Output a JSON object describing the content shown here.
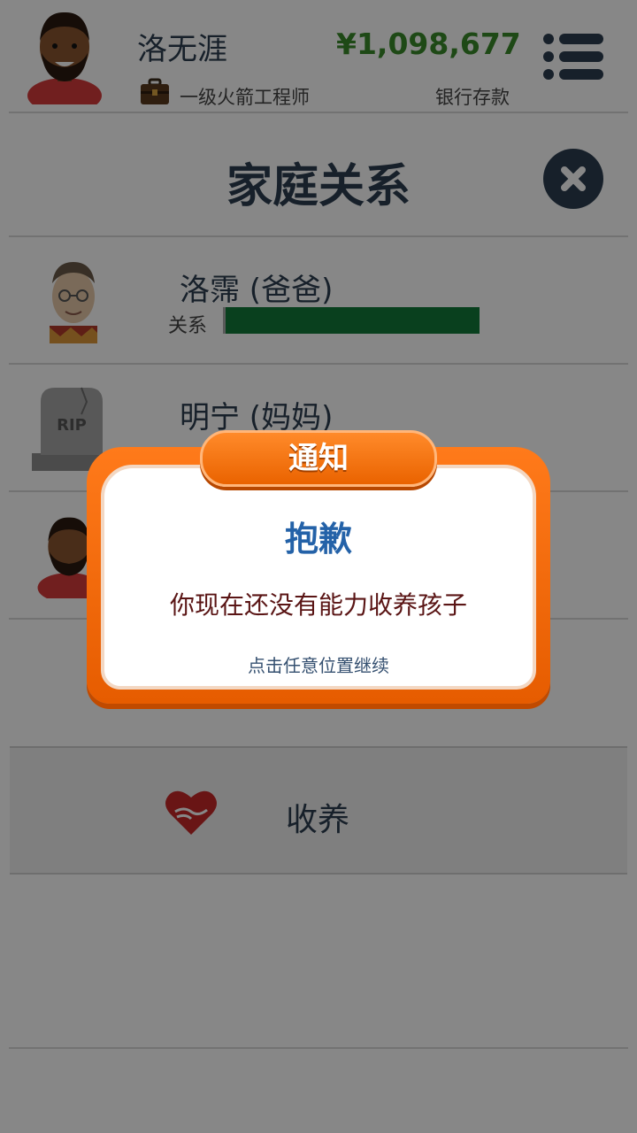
{
  "header": {
    "player_name": "洛无涯",
    "job_title": "一级火箭工程师",
    "money": "¥1,098,677",
    "bank_label": "银行存款",
    "icons": [
      "player-avatar",
      "briefcase-icon",
      "menu-icon"
    ]
  },
  "page": {
    "title": "家庭关系",
    "close_icon": "close-icon"
  },
  "relatives": [
    {
      "name": "洛霈 (爸爸)",
      "relation_label": "关系",
      "relationship_level": 1.0,
      "avatar": "elderly-man-avatar"
    },
    {
      "name": "明宁 (妈妈)",
      "avatar": "rip-tombstone-icon"
    },
    {
      "avatar": "bearded-man-avatar"
    }
  ],
  "adopt": {
    "label": "收养",
    "icon": "heart-hands-icon",
    "icon_color": "#c62828"
  },
  "modal": {
    "tab_title": "通知",
    "heading": "抱歉",
    "message": "你现在还没有能力收养孩子",
    "hint": "点击任意位置继续"
  },
  "colors": {
    "money": "#3a8a2a",
    "relationship_bar": "#127a3a",
    "modal_orange": "#f26b0f",
    "heading_blue": "#2462a8"
  }
}
